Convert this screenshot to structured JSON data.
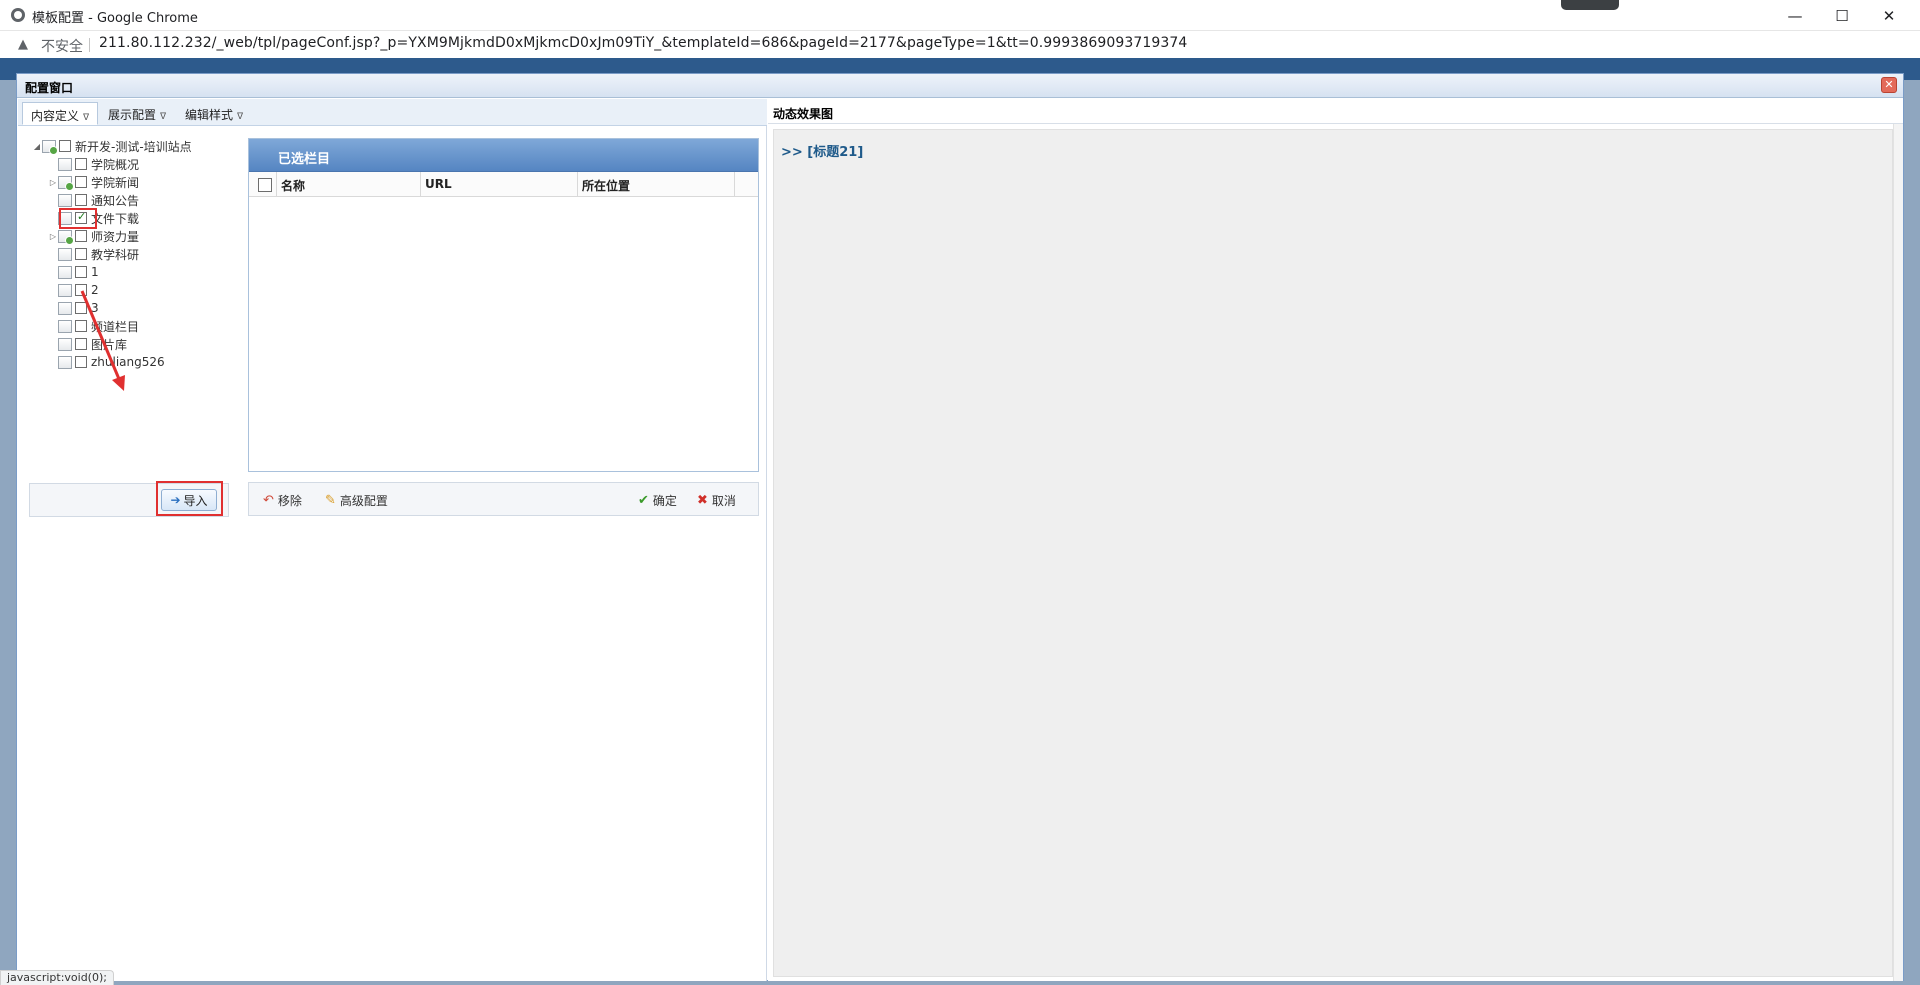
{
  "browser": {
    "window_title": "模板配置 - Google Chrome",
    "insecure_label": "不安全",
    "url": "211.80.112.232/_web/tpl/pageConf.jsp?_p=YXM9MjkmdD0xMjkmcD0xJm09TiY_&templateId=686&pageId=2177&pageType=1&tt=0.9993869093719374",
    "minimize_glyph": "—",
    "maximize_glyph": "☐",
    "close_glyph": "✕"
  },
  "dialog": {
    "title": "配置窗口",
    "close_glyph": "✕"
  },
  "tabs": [
    {
      "label": "内容定义",
      "active": true
    },
    {
      "label": "展示配置",
      "active": false
    },
    {
      "label": "编辑样式",
      "active": false
    }
  ],
  "tree": {
    "root": "新开发-测试-培训站点",
    "items": [
      {
        "label": "学院概况",
        "checked": false,
        "has_children": false
      },
      {
        "label": "学院新闻",
        "checked": false,
        "has_children": true
      },
      {
        "label": "通知公告",
        "checked": false,
        "has_children": false
      },
      {
        "label": "文件下载",
        "checked": true,
        "has_children": false
      },
      {
        "label": "师资力量",
        "checked": false,
        "has_children": true
      },
      {
        "label": "教学科研",
        "checked": false,
        "has_children": false
      },
      {
        "label": "1",
        "checked": false,
        "has_children": false
      },
      {
        "label": "2",
        "checked": false,
        "has_children": false
      },
      {
        "label": "3",
        "checked": false,
        "has_children": false
      },
      {
        "label": "频道栏目",
        "checked": false,
        "has_children": false
      },
      {
        "label": "图片库",
        "checked": false,
        "has_children": false
      },
      {
        "label": "zhuliang526",
        "checked": false,
        "has_children": false
      }
    ]
  },
  "import_button": "导入",
  "grid": {
    "title": "已选栏目",
    "columns": [
      "名称",
      "URL",
      "所在位置"
    ]
  },
  "toolbar": {
    "remove": "移除",
    "advanced": "高级配置",
    "confirm": "确定",
    "cancel": "取消"
  },
  "preview": {
    "title": "动态效果图",
    "link": ">> [标题21]"
  },
  "status_text": "javascript:void(0);",
  "colors": {
    "annotation_red": "#e03030",
    "grid_header": "#5585c2",
    "preview_link": "#1f5a8a"
  }
}
